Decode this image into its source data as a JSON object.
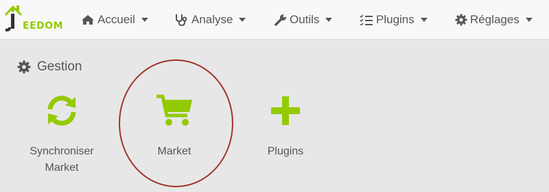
{
  "logo": {
    "text": "EEDOM",
    "icon": "jeedom-house-logo",
    "color": "#94ca02"
  },
  "nav": {
    "items": [
      {
        "label": "Accueil",
        "icon": "home-icon"
      },
      {
        "label": "Analyse",
        "icon": "stethoscope-icon"
      },
      {
        "label": "Outils",
        "icon": "wrench-icon"
      },
      {
        "label": "Plugins",
        "icon": "tasks-list-icon"
      },
      {
        "label": "Réglages",
        "icon": "gear-icon"
      }
    ]
  },
  "section": {
    "title": "Gestion",
    "icon": "gear-icon"
  },
  "tiles": [
    {
      "label_line1": "Synchroniser",
      "label_line2": "Market",
      "icon": "sync-icon"
    },
    {
      "label": "Market",
      "icon": "shopping-cart-icon"
    },
    {
      "label": "Plugins",
      "icon": "plus-icon"
    }
  ],
  "colors": {
    "accent": "#94ca02",
    "highlight": "#a3322c",
    "text": "#555555",
    "background": "#e7e7e7"
  }
}
